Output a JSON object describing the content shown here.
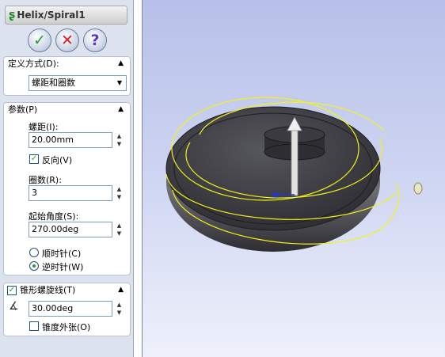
{
  "feature": {
    "title": "Helix/Spiral1",
    "icon": "helix-icon"
  },
  "actions": {
    "ok": "✓",
    "cancel": "✕",
    "help": "?"
  },
  "definition": {
    "header": "定义方式(D):",
    "value": "螺距和圈数"
  },
  "parameters": {
    "header": "参数(P)",
    "pitch_label": "螺距(I):",
    "pitch_value": "20.00mm",
    "reverse_label": "反向(V)",
    "reverse_checked": true,
    "revolutions_label": "圈数(R):",
    "revolutions_value": "3",
    "start_angle_label": "起始角度(S):",
    "start_angle_value": "270.00deg",
    "clockwise_label": "顺时针(C)",
    "counterclockwise_label": "逆时针(W)",
    "direction": "counterclockwise"
  },
  "taper": {
    "header": "锥形螺旋线(T)",
    "checked": true,
    "angle_value": "30.00deg",
    "outward_label": "锥度外张(O)",
    "outward_checked": false
  },
  "colors": {
    "helix": "#f2f21a",
    "model": "#3a3a3f",
    "axis": "#d8d8d8",
    "viewport_top": "#b7c0e9",
    "viewport_bottom": "#eef1fb"
  }
}
